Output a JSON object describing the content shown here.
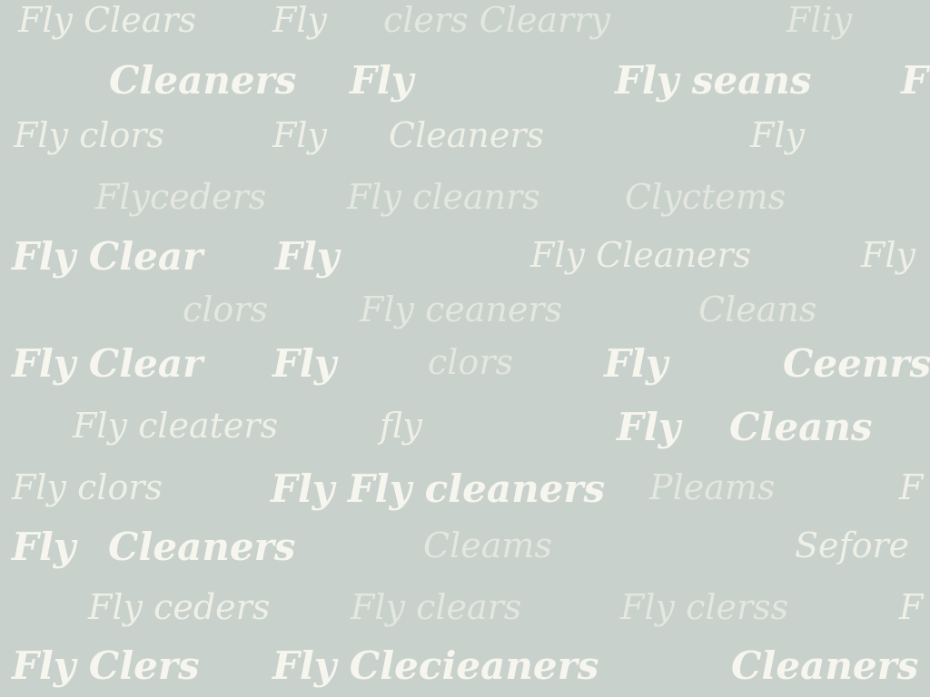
{
  "background_color": "#c9d1cd",
  "text_color": "#f6f6ef",
  "rows": [
    {
      "words": [
        "Fly Clears",
        "Fly",
        "clers Clearry",
        "Fliy"
      ]
    },
    {
      "words": [
        "Cleaners",
        "Fly",
        "Fly seans",
        "F"
      ]
    },
    {
      "words": [
        "Fly clors",
        "Fly",
        "Cleaners",
        "Fly"
      ]
    },
    {
      "words": [
        "Flyceders",
        "Fly cleanrs",
        "Clyctems"
      ]
    },
    {
      "words": [
        "Fly Clear",
        "Fly",
        "Fly Cleaners",
        "Fly"
      ]
    },
    {
      "words": [
        "clors",
        "Fly ceaners",
        "Cleans"
      ]
    },
    {
      "words": [
        "Fly Clear",
        "Fly",
        "clors",
        "Fly",
        "Ceenrs"
      ]
    },
    {
      "words": [
        "Fly cleaters",
        "fly",
        "Fly",
        "Cleans"
      ]
    },
    {
      "words": [
        "Fly clors",
        "Fly Fly cleaners",
        "Pleams",
        "F"
      ]
    },
    {
      "words": [
        "Fly",
        "Cleaners",
        "Cleams",
        "Sefore"
      ]
    },
    {
      "words": [
        "Fly ceders",
        "Fly clears",
        "Fly clerss",
        "F"
      ]
    },
    {
      "words": [
        "Fly Clers",
        "Fly Clecieaners",
        "Cleaners"
      ]
    }
  ]
}
